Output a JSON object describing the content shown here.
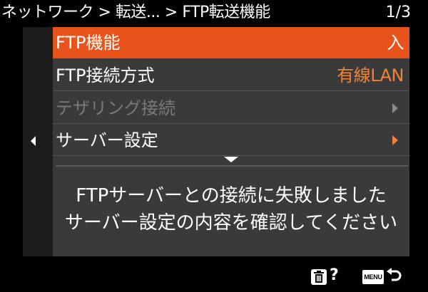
{
  "header": {
    "breadcrumb": "ネットワーク > 転送... > FTP転送機能",
    "page_indicator": "1/3"
  },
  "menu": {
    "items": [
      {
        "label": "FTP機能",
        "value": "入",
        "state": "selected"
      },
      {
        "label": "FTP接続方式",
        "value": "有線LAN",
        "state": "normal"
      },
      {
        "label": "テザリング接続",
        "value": "",
        "state": "disabled"
      },
      {
        "label": "サーバー設定",
        "value": "",
        "state": "normal"
      }
    ]
  },
  "message": {
    "line1": "FTPサーバーとの接続に失敗しました",
    "line2": "サーバー設定の内容を確認してください"
  },
  "footer": {
    "trash_icon": "trash-icon",
    "help_label": "?",
    "menu_button_label": "MENU",
    "return_icon": "return-icon"
  },
  "colors": {
    "selected_background": "#e8521b",
    "value_orange": "#f0823a",
    "panel_background": "#3a3a3a",
    "disabled_text": "#7a7a7a"
  }
}
